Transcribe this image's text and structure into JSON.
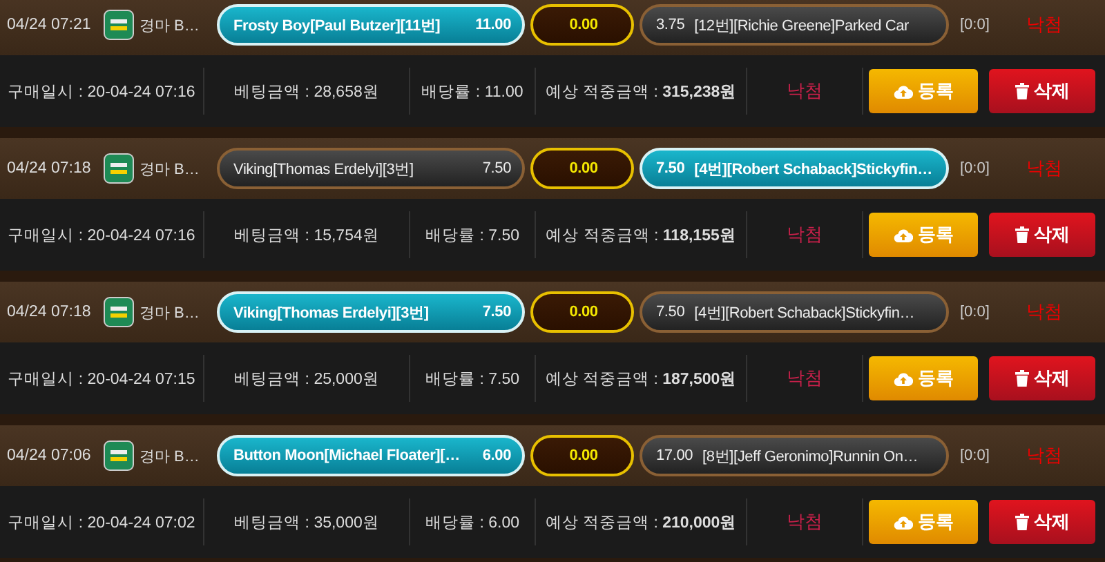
{
  "bets": [
    {
      "time": "04/24 07:21",
      "game": "경마 B…",
      "home": {
        "name": "Frosty Boy[Paul Butzer][11번]",
        "odds": "11.00",
        "selected": true
      },
      "draw": {
        "odds": "0.00",
        "selected": false
      },
      "away": {
        "odds": "3.75",
        "name": "[12번][Richie Greene]Parked Car",
        "selected": false
      },
      "score": "[0:0]",
      "result": "낙첨",
      "purchase": "구매일시 : 20-04-24 07:16",
      "amount": "베팅금액 : 28,658원",
      "rate": "배당률 : 11.00",
      "expected": "예상 적중금액 : **315,238원**",
      "status": "낙첨",
      "register": "등록",
      "delete": "삭제"
    },
    {
      "time": "04/24 07:18",
      "game": "경마 B…",
      "home": {
        "name": "Viking[Thomas Erdelyi][3번]",
        "odds": "7.50",
        "selected": false
      },
      "draw": {
        "odds": "0.00",
        "selected": false
      },
      "away": {
        "odds": "7.50",
        "name": "[4번][Robert Schaback]Stickyfin…",
        "selected": true
      },
      "score": "[0:0]",
      "result": "낙첨",
      "purchase": "구매일시 : 20-04-24 07:16",
      "amount": "베팅금액 : 15,754원",
      "rate": "배당률 : 7.50",
      "expected": "예상 적중금액 : **118,155원**",
      "status": "낙첨",
      "register": "등록",
      "delete": "삭제"
    },
    {
      "time": "04/24 07:18",
      "game": "경마 B…",
      "home": {
        "name": "Viking[Thomas Erdelyi][3번]",
        "odds": "7.50",
        "selected": true
      },
      "draw": {
        "odds": "0.00",
        "selected": false
      },
      "away": {
        "odds": "7.50",
        "name": "[4번][Robert Schaback]Stickyfin…",
        "selected": false
      },
      "score": "[0:0]",
      "result": "낙첨",
      "purchase": "구매일시 : 20-04-24 07:15",
      "amount": "베팅금액 : 25,000원",
      "rate": "배당률 : 7.50",
      "expected": "예상 적중금액 : **187,500원**",
      "status": "낙첨",
      "register": "등록",
      "delete": "삭제"
    },
    {
      "time": "04/24 07:06",
      "game": "경마 B…",
      "home": {
        "name": "Button Moon[Michael Floater][…",
        "odds": "6.00",
        "selected": true
      },
      "draw": {
        "odds": "0.00",
        "selected": false
      },
      "away": {
        "odds": "17.00",
        "name": "[8번][Jeff Geronimo]Runnin On…",
        "selected": false
      },
      "score": "[0:0]",
      "result": "낙첨",
      "purchase": "구매일시 : 20-04-24 07:02",
      "amount": "베팅금액 : 35,000원",
      "rate": "배당률 : 6.00",
      "expected": "예상 적중금액 : **210,000원**",
      "status": "낙첨",
      "register": "등록",
      "delete": "삭제"
    }
  ]
}
